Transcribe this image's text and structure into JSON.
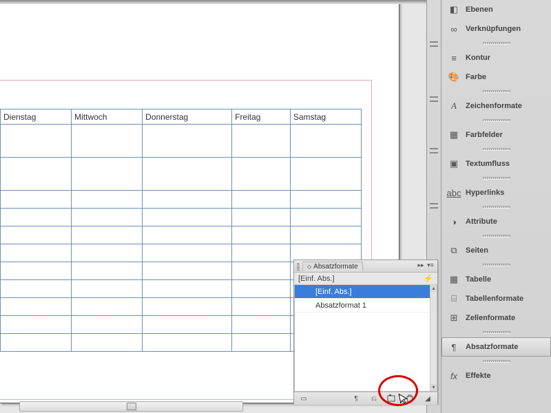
{
  "table": {
    "headers": [
      "Dienstag",
      "Mittwoch",
      "Donnerstag",
      "Freitag",
      "Samstag"
    ]
  },
  "panels": {
    "items": [
      {
        "icon": "layers-icon",
        "label": "Ebenen"
      },
      {
        "icon": "links-icon",
        "label": "Verknüpfungen"
      },
      {
        "icon": "stroke-icon",
        "label": "Kontur"
      },
      {
        "icon": "color-icon",
        "label": "Farbe"
      },
      {
        "icon": "char-styles-icon",
        "label": "Zeichenformate"
      },
      {
        "icon": "swatches-icon",
        "label": "Farbfelder"
      },
      {
        "icon": "textwrap-icon",
        "label": "Textumfluss"
      },
      {
        "icon": "hyperlinks-icon",
        "label": "Hyperlinks"
      },
      {
        "icon": "attributes-icon",
        "label": "Attribute"
      },
      {
        "icon": "pages-icon",
        "label": "Seiten"
      },
      {
        "icon": "table-icon",
        "label": "Tabelle"
      },
      {
        "icon": "table-styles-icon",
        "label": "Tabellenformate"
      },
      {
        "icon": "cell-styles-icon",
        "label": "Zellenformate"
      },
      {
        "icon": "para-styles-icon",
        "label": "Absatzformate"
      },
      {
        "icon": "effects-icon",
        "label": "Effekte"
      }
    ],
    "selected": "Absatzformate"
  },
  "floating_panel": {
    "title": "Absatzformate",
    "sub": "[Einf. Abs.]",
    "rows": [
      {
        "label": "[Einf. Abs.]",
        "selected": true
      },
      {
        "label": "Absatzformat 1",
        "selected": false
      }
    ]
  }
}
